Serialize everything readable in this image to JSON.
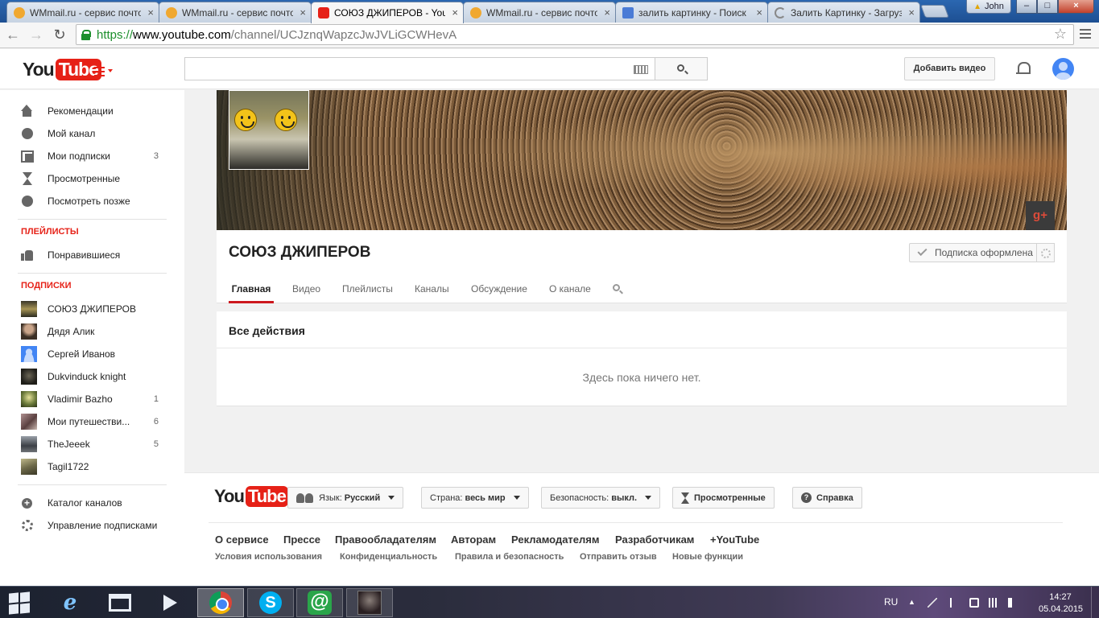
{
  "browser": {
    "tabs": [
      {
        "title": "WMmail.ru - сервис почтов",
        "favicon": "wmmail-icon",
        "active": false
      },
      {
        "title": "WMmail.ru - сервис почтов",
        "favicon": "wmmail-icon",
        "active": false
      },
      {
        "title": "СОЮЗ ДЖИПЕРОВ - YouTube",
        "favicon": "youtube-icon",
        "active": true
      },
      {
        "title": "WMmail.ru - сервис почтов",
        "favicon": "wmmail-icon",
        "active": false
      },
      {
        "title": "залить картинку - Поиск",
        "favicon": "google-icon",
        "active": false
      },
      {
        "title": "Залить Картинку - Загрузи",
        "favicon": "loading-icon",
        "active": false
      }
    ],
    "profile_name": "John",
    "url": {
      "scheme": "https://",
      "host": "www.youtube.com",
      "path": "/channel/UCJznqWapzcJwJVLiGCWHevA"
    }
  },
  "masthead": {
    "logo_you": "You",
    "logo_tube": "Tube",
    "search_placeholder": "",
    "upload_label": "Добавить видео"
  },
  "guide": {
    "main_items": [
      {
        "label": "Рекомендации",
        "icon": "home-icon",
        "count": ""
      },
      {
        "label": "Мой канал",
        "icon": "user-icon",
        "count": ""
      },
      {
        "label": "Мои подписки",
        "icon": "subscriptions-icon",
        "count": "3"
      },
      {
        "label": "Просмотренные",
        "icon": "history-icon",
        "count": ""
      },
      {
        "label": "Посмотреть позже",
        "icon": "clock-icon",
        "count": ""
      }
    ],
    "playlists_heading": "ПЛЕЙЛИСТЫ",
    "playlist_items": [
      {
        "label": "Понравившиеся",
        "icon": "thumbs-up-icon"
      }
    ],
    "subscriptions_heading": "ПОДПИСКИ",
    "subscriptions": [
      {
        "label": "СОЮЗ ДЖИПЕРОВ",
        "count": "",
        "color": "#8a7a45"
      },
      {
        "label": "Дядя Алик",
        "count": "",
        "color": "#5a4a3a"
      },
      {
        "label": "Сергей Иванов",
        "count": "",
        "color": "#4285f4"
      },
      {
        "label": "Dukvinduck knight",
        "count": "",
        "color": "#3a3830"
      },
      {
        "label": "Vladimir Bazho",
        "count": "1",
        "color": "#6b7a3a"
      },
      {
        "label": "Мои путешестви...",
        "count": "6",
        "color": "#7a5a5a"
      },
      {
        "label": "TheJeeek",
        "count": "5",
        "color": "#555a60"
      },
      {
        "label": "Tagil1722",
        "count": "",
        "color": "#6e6a4a"
      }
    ],
    "bottom_items": [
      {
        "label": "Каталог каналов",
        "icon": "plus-circle-icon"
      },
      {
        "label": "Управление подписками",
        "icon": "gear-icon"
      }
    ]
  },
  "channel": {
    "title": "СОЮЗ ДЖИПЕРОВ",
    "subscribe_label": "Подписка оформлена",
    "gplus_label": "g+",
    "tabs": [
      "Главная",
      "Видео",
      "Плейлисты",
      "Каналы",
      "Обсуждение",
      "О канале"
    ],
    "active_tab": "Главная",
    "feed_title": "Все действия",
    "feed_empty": "Здесь пока ничего нет."
  },
  "footer": {
    "logo_you": "You",
    "logo_tube": "Tube",
    "language_label": "Язык:",
    "language_value": "Русский",
    "country_label": "Страна:",
    "country_value": "весь мир",
    "safety_label": "Безопасность:",
    "safety_value": "выкл.",
    "history_label": "Просмотренные",
    "help_label": "Справка",
    "help_glyph": "?",
    "links": [
      "О сервисе",
      "Прессе",
      "Правообладателям",
      "Авторам",
      "Рекламодателям",
      "Разработчикам",
      "+YouTube"
    ],
    "small_links": [
      "Условия использования",
      "Конфиденциальность",
      "Правила и безопасность",
      "Отправить отзыв",
      "Новые функции"
    ]
  },
  "taskbar": {
    "language": "RU",
    "time": "14:27",
    "date": "05.04.2015",
    "apps": [
      "internet-explorer-icon",
      "file-explorer-icon",
      "media-player-icon",
      "chrome-icon",
      "skype-icon",
      "mail-agent-icon",
      "game-icon"
    ],
    "skype_glyph": "S",
    "mail_glyph": "@",
    "ie_glyph": "e"
  },
  "colors": {
    "brand_red": "#e62117",
    "tab_underline": "#cc181e",
    "secure_green": "#1c8f2c"
  }
}
